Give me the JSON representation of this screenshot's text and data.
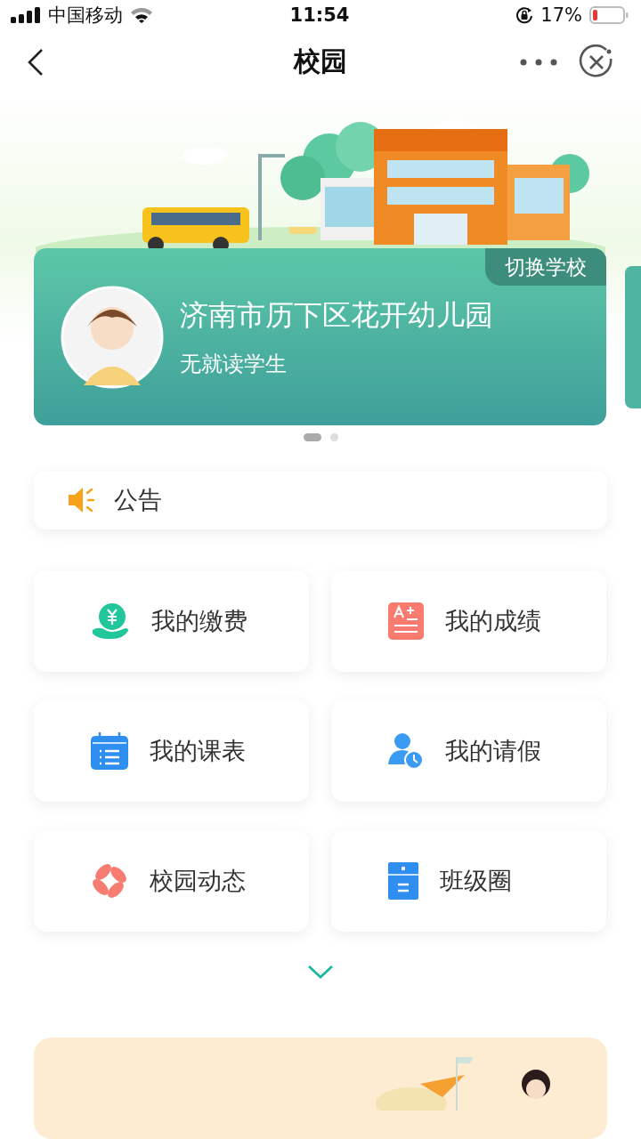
{
  "status_bar": {
    "carrier": "中国移动",
    "time": "11:54",
    "battery": "17%"
  },
  "nav": {
    "title": "校园"
  },
  "school_card": {
    "switch_label": "切换学校",
    "school_name": "济南市历下区花开幼儿园",
    "student": "无就读学生"
  },
  "carousel_dots": [
    {
      "selected": true
    },
    {
      "selected": false
    }
  ],
  "notice": {
    "label": "公告"
  },
  "features": [
    {
      "kind": "pay",
      "label": "我的缴费",
      "color": "#1fc79a"
    },
    {
      "kind": "grade",
      "label": "我的成绩",
      "color": "#f97a6e"
    },
    {
      "kind": "schedule",
      "label": "我的课表",
      "color": "#2e8ff0"
    },
    {
      "kind": "leave",
      "label": "我的请假",
      "color": "#3b9af2"
    },
    {
      "kind": "news",
      "label": "校园动态",
      "color": "#f77d72"
    },
    {
      "kind": "class",
      "label": "班级圈",
      "color": "#2e8ff0"
    }
  ],
  "expand": {
    "expanded": false
  }
}
